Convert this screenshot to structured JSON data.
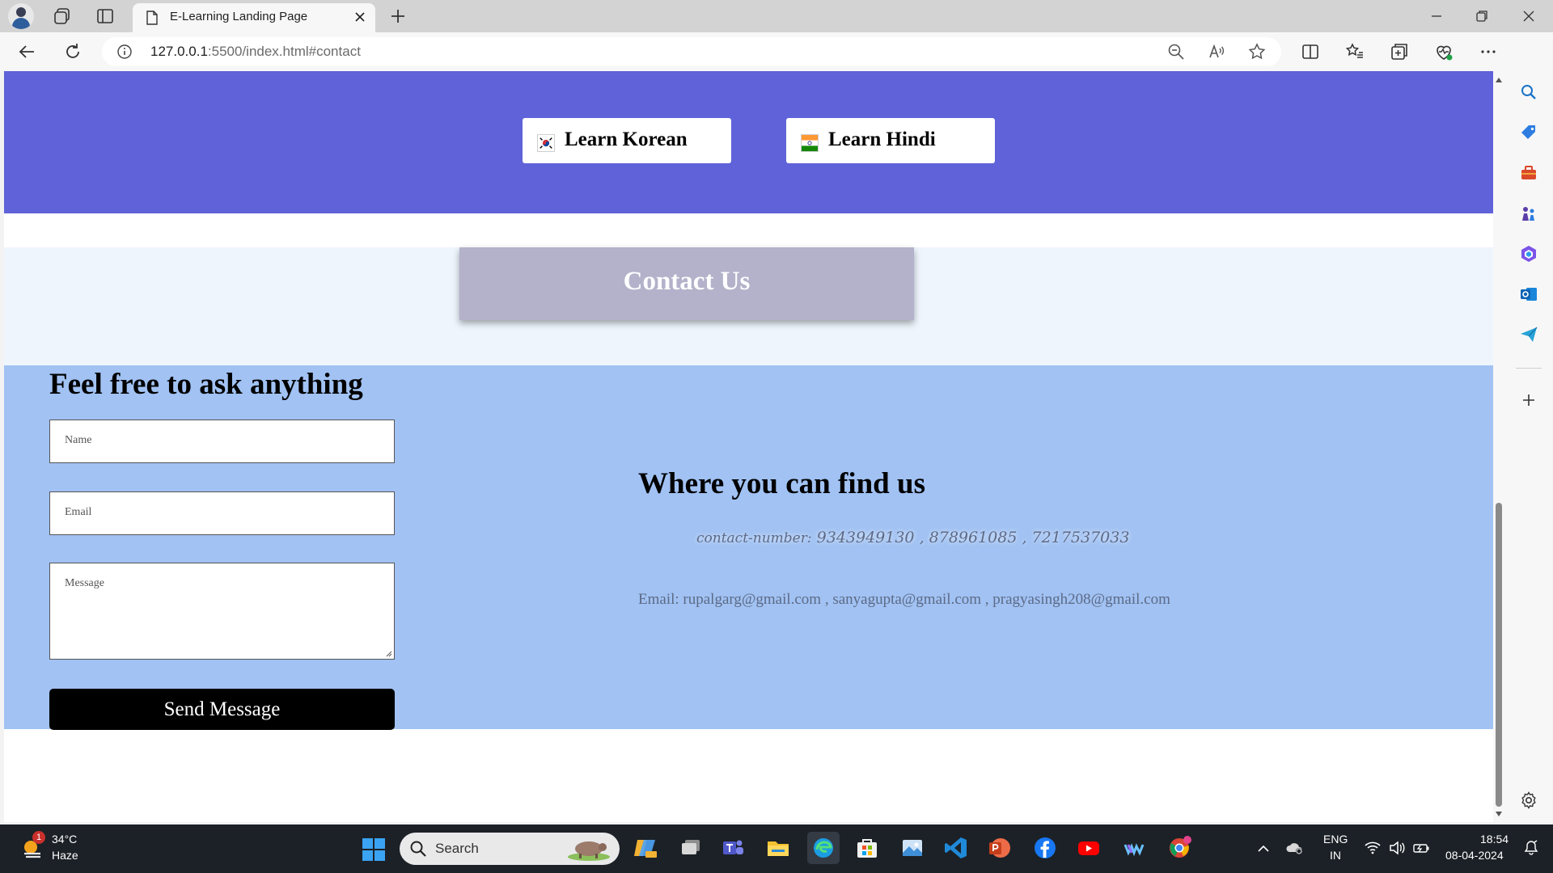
{
  "browser": {
    "tab_title": "E-Learning Landing Page",
    "url_host": "127.0.0.1",
    "url_rest": ":5500/index.html#contact"
  },
  "languages": [
    {
      "label": "Learn Korean",
      "flag": "korea-flag-icon"
    },
    {
      "label": "Learn Hindi",
      "flag": "india-flag-icon"
    }
  ],
  "contact": {
    "heading": "Contact Us",
    "form_title": "Feel free to ask anything",
    "name_placeholder": "Name",
    "email_placeholder": "Email",
    "message_placeholder": "Message",
    "send_label": "Send Message",
    "find_title": "Where you can find us",
    "phone_label": "contact-number:",
    "phone_numbers": "9343949130 , 878961085 , 7217537033",
    "email_line": "Email: rupalgarg@gmail.com , sanyagupta@gmail.com , pragyasingh208@gmail.com"
  },
  "colors": {
    "language_band": "#5f62d8",
    "contact_heading_bg": "#b3b2ca",
    "form_band": "#a1c2f3",
    "send_button": "#000000"
  },
  "taskbar": {
    "weather_temp": "34°C",
    "weather_condition": "Haze",
    "weather_badge": "1",
    "search_label": "Search",
    "lang_line1": "ENG",
    "lang_line2": "IN",
    "time": "18:54",
    "date": "08-04-2024"
  }
}
